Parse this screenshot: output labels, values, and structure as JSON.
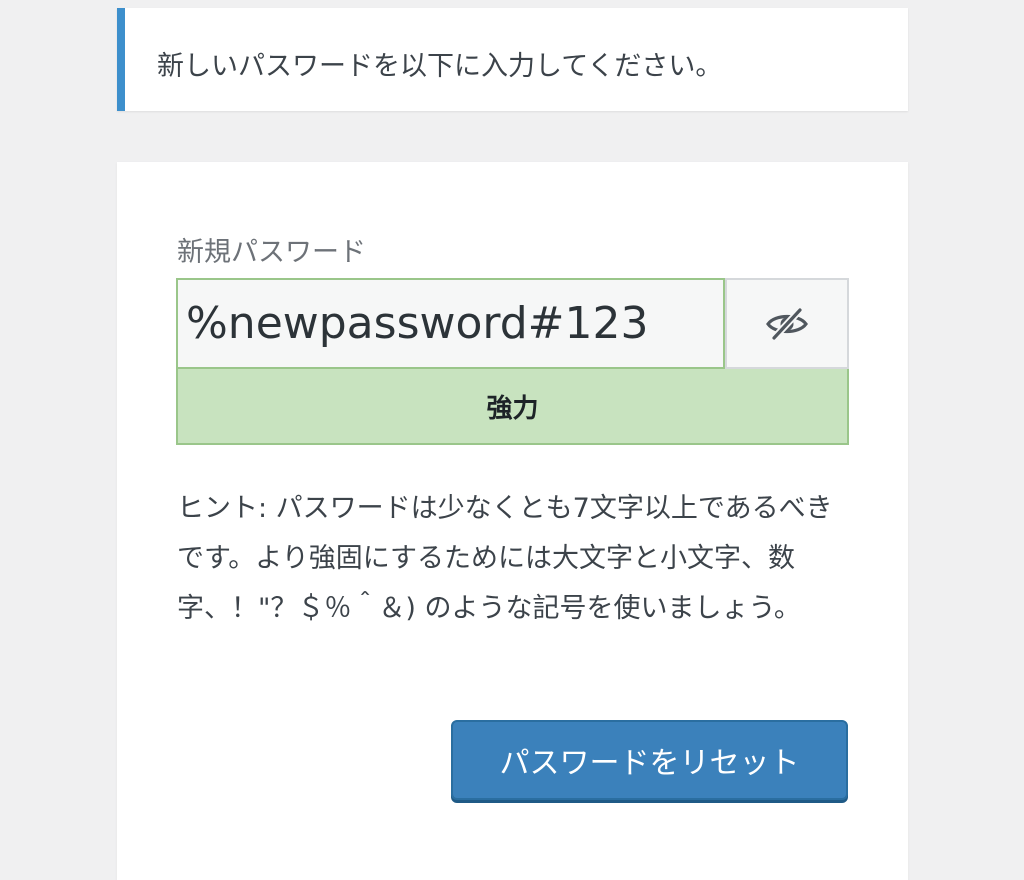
{
  "notice": {
    "message": "新しいパスワードを以下に入力してください。"
  },
  "form": {
    "new_password_label": "新規パスワード",
    "password_value": "%newpassword#123",
    "toggle_icon": "eye-slash-icon",
    "strength_label": "強力",
    "hint_text": "ヒント: パスワードは少なくとも7文字以上であるべきです。より強固にするためには大文字と小文字、数字、！\"？＄％＾＆) のような記号を使いましょう。",
    "reset_button_label": "パスワードをリセット"
  },
  "colors": {
    "accent_blue": "#3b81bb",
    "strength_strong_bg": "#c8e3bf",
    "strength_strong_border": "#9ac68a",
    "notice_border": "#3d8fcc"
  }
}
